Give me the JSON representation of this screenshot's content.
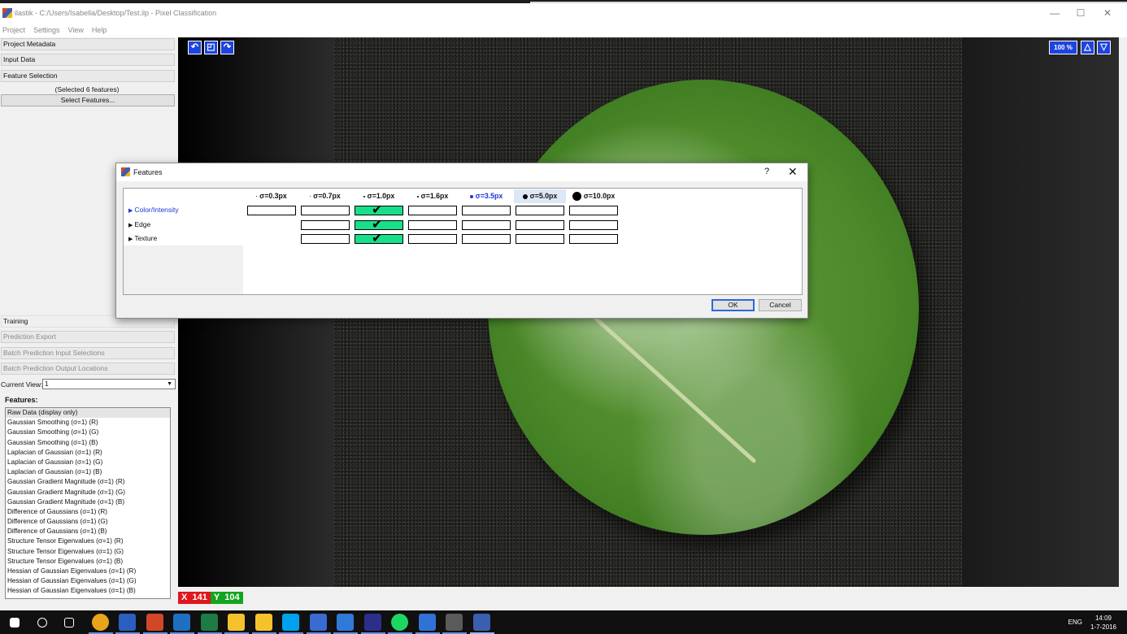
{
  "window": {
    "title": "ilastik - C:/Users/Isabella/Desktop/Test.ilp - Pixel Classification",
    "controls": [
      "—",
      "☐",
      "✕"
    ]
  },
  "menu": [
    "Project",
    "Settings",
    "View",
    "Help"
  ],
  "applets": {
    "top": [
      "Project Metadata",
      "Input Data",
      "Feature Selection"
    ],
    "selected_count": "(Selected 6 features)",
    "select_button": "Select Features...",
    "training": "Training",
    "bottom": [
      "Prediction Export",
      "Batch Prediction Input Selections",
      "Batch Prediction Output Locations"
    ]
  },
  "current_view": {
    "label": "Current View:",
    "value": "1"
  },
  "features_list": {
    "heading": "Features:",
    "items": [
      "Raw Data (display only)",
      "Gaussian Smoothing (σ=1) (R)",
      "Gaussian Smoothing (σ=1) (G)",
      "Gaussian Smoothing (σ=1) (B)",
      "Laplacian of Gaussian (σ=1) (R)",
      "Laplacian of Gaussian (σ=1) (G)",
      "Laplacian of Gaussian (σ=1) (B)",
      "Gaussian Gradient Magnitude (σ=1) (R)",
      "Gaussian Gradient Magnitude (σ=1) (G)",
      "Gaussian Gradient Magnitude (σ=1) (B)",
      "Difference of Gaussians (σ=1) (R)",
      "Difference of Gaussians (σ=1) (G)",
      "Difference of Gaussians (σ=1) (B)",
      "Structure Tensor Eigenvalues (σ=1) (R)",
      "Structure Tensor Eigenvalues (σ=1) (G)",
      "Structure Tensor Eigenvalues (σ=1) (B)",
      "Hessian of Gaussian Eigenvalues (σ=1) (R)",
      "Hessian of Gaussian Eigenvalues (σ=1) (G)",
      "Hessian of Gaussian Eigenvalues (σ=1) (B)"
    ]
  },
  "viewer": {
    "tools": [
      "undo-icon",
      "fit-icon",
      "redo-icon"
    ],
    "zoom": "100 %",
    "zoom_buttons": [
      "△",
      "▽"
    ],
    "position": {
      "x_label": "X",
      "x_value": "141",
      "y_label": "Y",
      "y_value": "104"
    }
  },
  "dialog": {
    "title": "Features",
    "help": "?",
    "close": "✕",
    "scales": [
      "σ=0.3px",
      "σ=0.7px",
      "σ=1.0px",
      "σ=1.6px",
      "σ=3.5px",
      "σ=5.0px",
      "σ=10.0px"
    ],
    "groups": [
      {
        "label": "Color/Intensity",
        "checked": [
          false,
          false,
          true,
          false,
          false,
          false,
          false
        ],
        "available": [
          true,
          true,
          true,
          true,
          true,
          true,
          true
        ]
      },
      {
        "label": "Edge",
        "checked": [
          false,
          false,
          true,
          false,
          false,
          false,
          false
        ],
        "available": [
          false,
          true,
          true,
          true,
          true,
          true,
          true
        ]
      },
      {
        "label": "Texture",
        "checked": [
          false,
          false,
          true,
          false,
          false,
          false,
          false
        ],
        "available": [
          false,
          true,
          true,
          true,
          true,
          true,
          true
        ]
      }
    ],
    "ok": "OK",
    "cancel": "Cancel"
  },
  "taskbar": {
    "apps": [
      "start-icon",
      "search-icon",
      "task-view-icon",
      "chrome-icon",
      "word-icon",
      "powerpoint-icon",
      "outlook-icon",
      "excel-icon",
      "file-explorer-icon",
      "folder-icon",
      "skype-icon",
      "keyboard-app-icon",
      "photos-icon",
      "photoshop-icon",
      "spotify-icon",
      "window-app-icon",
      "terminal-icon",
      "ilastik-icon"
    ],
    "lang": "ENG",
    "time": "14:09",
    "date": "1-7-2016"
  },
  "colors": {
    "accent_blue": "#1e44e0",
    "checked_green": "#18e08a",
    "x_red": "#e0151d",
    "y_green": "#12a51e"
  }
}
